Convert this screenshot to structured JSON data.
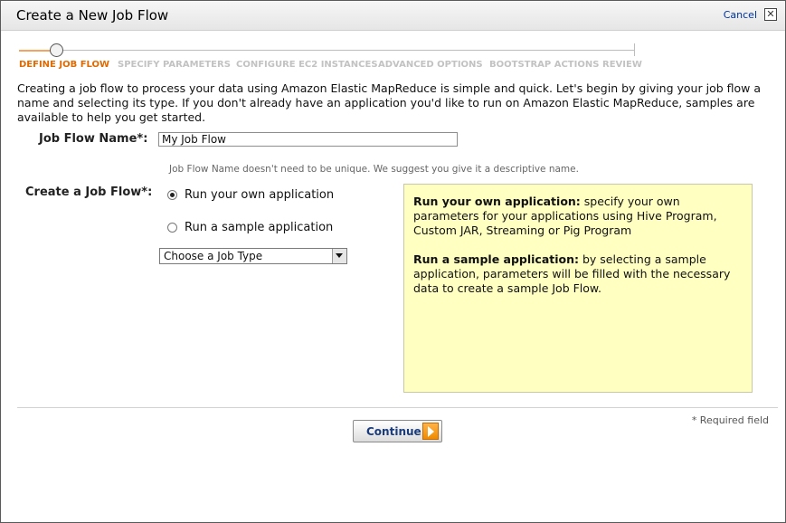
{
  "dialog": {
    "title": "Create a New Job Flow",
    "cancel_label": "Cancel",
    "close_glyph": "✕"
  },
  "steps": [
    {
      "label": "DEFINE JOB FLOW",
      "active": true
    },
    {
      "label": "SPECIFY PARAMETERS",
      "active": false
    },
    {
      "label": "CONFIGURE EC2 INSTANCES",
      "active": false
    },
    {
      "label": "ADVANCED OPTIONS",
      "active": false
    },
    {
      "label": "BOOTSTRAP ACTIONS",
      "active": false
    },
    {
      "label": "REVIEW",
      "active": false
    }
  ],
  "intro": "Creating a job flow to process your data using Amazon Elastic MapReduce is simple and quick. Let's begin by giving your job flow a name and selecting its type. If you don't already have an application you'd like to run on Amazon Elastic MapReduce, samples are available to help you get started.",
  "job_flow_name": {
    "label": "Job Flow Name*:",
    "value": "My Job Flow",
    "hint": "Job Flow Name doesn't need to be unique. We suggest you give it a descriptive name."
  },
  "create_job_flow": {
    "label": "Create a Job Flow*:",
    "options": [
      {
        "label": "Run your own application",
        "checked": true
      },
      {
        "label": "Run a sample application",
        "checked": false
      }
    ],
    "job_type_selected": "Choose a Job Type"
  },
  "info": {
    "own_title": "Run your own application:",
    "own_text": " specify your own parameters for your applications using Hive Program, Custom JAR, Streaming or Pig Program",
    "sample_title": "Run a sample application:",
    "sample_text": " by selecting a sample application, parameters will be filled with the necessary data to create a sample Job Flow."
  },
  "footer": {
    "required_note": "* Required field",
    "continue_label": "Continue"
  },
  "colors": {
    "active_step": "#e06a00",
    "inactive_step": "#c2c2c2",
    "info_bg": "#ffffc2",
    "button_arrow": "#f08a00"
  }
}
